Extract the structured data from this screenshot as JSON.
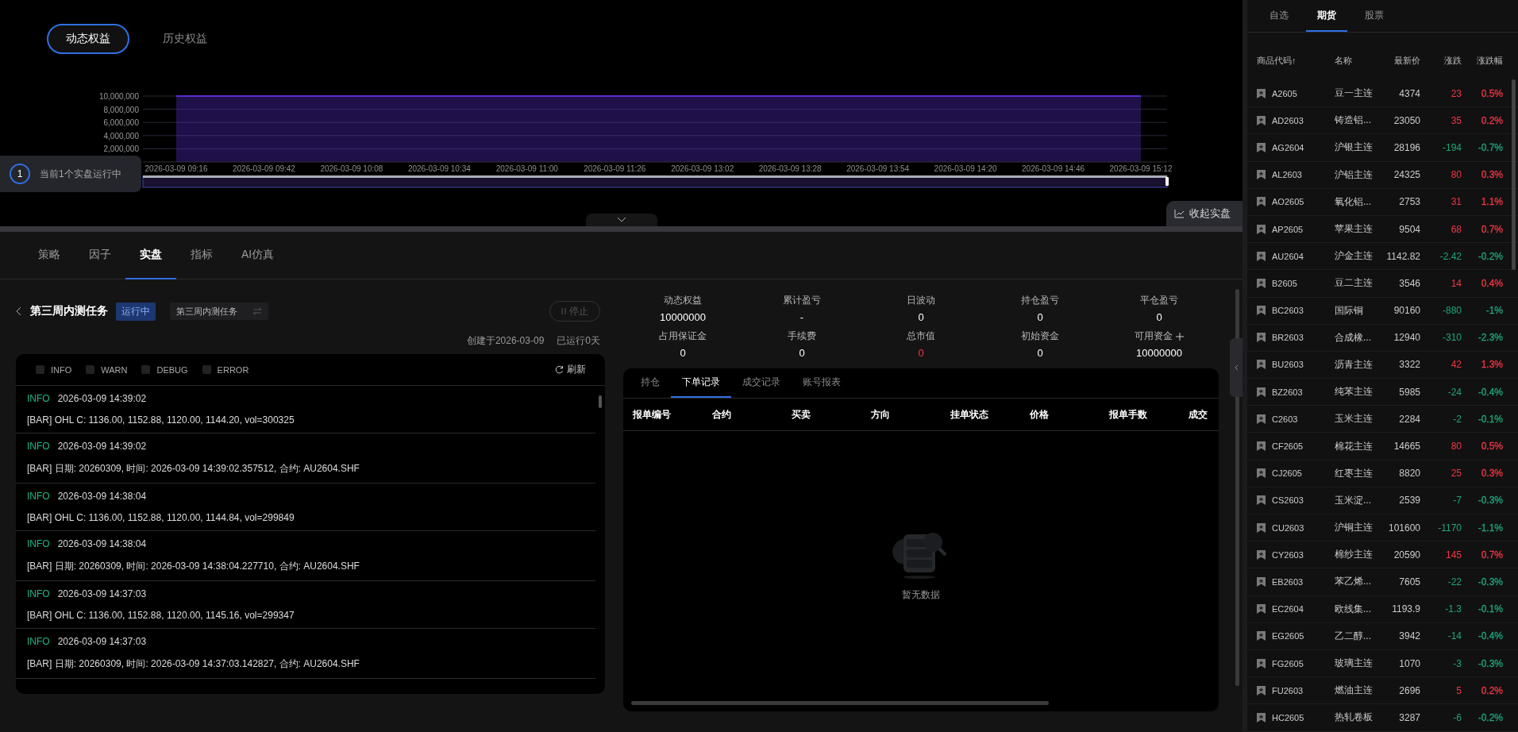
{
  "chart_tabs": [
    {
      "label": "动态权益",
      "selected": true
    },
    {
      "label": "历史权益",
      "selected": false
    }
  ],
  "equity_chart": {
    "chart_data": {
      "type": "area",
      "categories": [
        "2026-03-09 09:16",
        "2026-03-09 09:42",
        "2026-03-09 10:08",
        "2026-03-09 10:34",
        "2026-03-09 11:00",
        "2026-03-09 11:26",
        "2026-03-09 13:02",
        "2026-03-09 13:28",
        "2026-03-09 13:54",
        "2026-03-09 14:20",
        "2026-03-09 14:46",
        "2026-03-09 15:12"
      ],
      "series": [
        {
          "color": "#5a2fd0",
          "values": [
            10000000,
            10000000,
            10000000,
            10000000,
            10000000,
            10000000,
            10000000,
            10000000,
            10000000,
            10000000,
            10000000,
            10000000
          ]
        }
      ],
      "ylim": [
        0,
        10000000
      ],
      "grid": true,
      "yticks": [
        {
          "value": 2000000,
          "label": "2,000,000"
        },
        {
          "value": 4000000,
          "label": "4,000,000"
        },
        {
          "value": 6000000,
          "label": "6,000,000"
        },
        {
          "value": 8000000,
          "label": "8,000,000"
        },
        {
          "value": 10000000,
          "label": "10,000,000"
        }
      ]
    }
  },
  "running_notice": {
    "count": "1",
    "text": "当前1个实盘运行中"
  },
  "collapse_button": "收起实盘",
  "main_tabs": [
    {
      "label": "策略",
      "selected": false
    },
    {
      "label": "因子",
      "selected": false
    },
    {
      "label": "实盘",
      "selected": true
    },
    {
      "label": "指标",
      "selected": false
    },
    {
      "label": "AI仿真",
      "selected": false
    }
  ],
  "task": {
    "title": "第三周内测任务",
    "status": "运行中",
    "selector": "第三周内测任务",
    "stop_button": "停止",
    "disabled": true,
    "created": "创建于2026-03-09",
    "runtime": "已运行0天"
  },
  "stats": [
    {
      "label": "动态权益",
      "value": "10000000",
      "kind": "plain"
    },
    {
      "label": "累计盈亏",
      "value": "-",
      "kind": "plain"
    },
    {
      "label": "日波动",
      "value": "0",
      "kind": "plain"
    },
    {
      "label": "持仓盈亏",
      "value": "0",
      "kind": "plain"
    },
    {
      "label": "平仓盈亏",
      "value": "0",
      "kind": "plain"
    },
    {
      "label": "占用保证金",
      "value": "0",
      "kind": "plain"
    },
    {
      "label": "手续费",
      "value": "0",
      "kind": "plain"
    },
    {
      "label": "总市值",
      "value": "0",
      "kind": "alert"
    },
    {
      "label": "初始资金",
      "value": "0",
      "kind": "plain"
    },
    {
      "label": "可用资金",
      "value": "10000000",
      "kind": "add"
    }
  ],
  "log_panel": {
    "filters": [
      {
        "label": "INFO",
        "checked": false
      },
      {
        "label": "WARN",
        "checked": false
      },
      {
        "label": "DEBUG",
        "checked": false
      },
      {
        "label": "ERROR",
        "checked": false
      }
    ],
    "refresh": "刷新",
    "entries": [
      {
        "level": "INFO",
        "time": "2026-03-09 14:39:02",
        "message": "[BAR] OHL C: 1136.00, 1152.88, 1120.00, 1144.20, vol=300325"
      },
      {
        "level": "INFO",
        "time": "2026-03-09 14:39:02",
        "message": "[BAR] 日期: 20260309, 时间: 2026-03-09 14:39:02.357512, 合约: AU2604.SHF"
      },
      {
        "level": "INFO",
        "time": "2026-03-09 14:38:04",
        "message": "[BAR] OHL C: 1136.00, 1152.88, 1120.00, 1144.84, vol=299849"
      },
      {
        "level": "INFO",
        "time": "2026-03-09 14:38:04",
        "message": "[BAR] 日期: 20260309, 时间: 2026-03-09 14:38:04.227710, 合约: AU2604.SHF"
      },
      {
        "level": "INFO",
        "time": "2026-03-09 14:37:03",
        "message": "[BAR] OHL C: 1136.00, 1152.88, 1120.00, 1145.16, vol=299347"
      },
      {
        "level": "INFO",
        "time": "2026-03-09 14:37:03",
        "message": "[BAR] 日期: 20260309, 时间: 2026-03-09 14:37:03.142827, 合约: AU2604.SHF"
      }
    ]
  },
  "orders_panel": {
    "tabs": [
      {
        "label": "持仓",
        "selected": false
      },
      {
        "label": "下单记录",
        "selected": true
      },
      {
        "label": "成交记录",
        "selected": false
      },
      {
        "label": "账号报表",
        "selected": false
      }
    ],
    "columns": [
      "报单编号",
      "合约",
      "买卖",
      "方向",
      "挂单状态",
      "价格",
      "报单手数",
      "成交"
    ],
    "empty_text": "暂无数据"
  },
  "watchlist": {
    "tabs": [
      {
        "label": "自选",
        "selected": false
      },
      {
        "label": "期货",
        "selected": true
      },
      {
        "label": "股票",
        "selected": false
      }
    ],
    "columns": [
      "商品代码↑",
      "名称",
      "最新价",
      "涨跌",
      "涨跌幅"
    ],
    "rows": [
      {
        "code": "A2605",
        "name": "豆一主连",
        "price": "4374",
        "change": "23",
        "pct": "0.5%",
        "color": "#f23645"
      },
      {
        "code": "AD2603",
        "name": "铸造铝...",
        "price": "23050",
        "change": "35",
        "pct": "0.2%",
        "color": "#f23645"
      },
      {
        "code": "AG2604",
        "name": "沪银主连",
        "price": "28196",
        "change": "-194",
        "pct": "-0.7%",
        "color": "#1fa67a"
      },
      {
        "code": "AL2603",
        "name": "沪铝主连",
        "price": "24325",
        "change": "80",
        "pct": "0.3%",
        "color": "#f23645"
      },
      {
        "code": "AO2605",
        "name": "氧化铝...",
        "price": "2753",
        "change": "31",
        "pct": "1.1%",
        "color": "#f23645"
      },
      {
        "code": "AP2605",
        "name": "苹果主连",
        "price": "9504",
        "change": "68",
        "pct": "0.7%",
        "color": "#f23645"
      },
      {
        "code": "AU2604",
        "name": "沪金主连",
        "price": "1142.82",
        "change": "-2.42",
        "pct": "-0.2%",
        "color": "#1fa67a"
      },
      {
        "code": "B2605",
        "name": "豆二主连",
        "price": "3546",
        "change": "14",
        "pct": "0.4%",
        "color": "#f23645"
      },
      {
        "code": "BC2603",
        "name": "国际铜",
        "price": "90160",
        "change": "-880",
        "pct": "-1%",
        "color": "#1fa67a"
      },
      {
        "code": "BR2603",
        "name": "合成橡...",
        "price": "12940",
        "change": "-310",
        "pct": "-2.3%",
        "color": "#1fa67a"
      },
      {
        "code": "BU2603",
        "name": "沥青主连",
        "price": "3322",
        "change": "42",
        "pct": "1.3%",
        "color": "#f23645"
      },
      {
        "code": "BZ2603",
        "name": "纯苯主连",
        "price": "5985",
        "change": "-24",
        "pct": "-0.4%",
        "color": "#1fa67a"
      },
      {
        "code": "C2603",
        "name": "玉米主连",
        "price": "2284",
        "change": "-2",
        "pct": "-0.1%",
        "color": "#1fa67a"
      },
      {
        "code": "CF2605",
        "name": "棉花主连",
        "price": "14665",
        "change": "80",
        "pct": "0.5%",
        "color": "#f23645"
      },
      {
        "code": "CJ2605",
        "name": "红枣主连",
        "price": "8820",
        "change": "25",
        "pct": "0.3%",
        "color": "#f23645"
      },
      {
        "code": "CS2603",
        "name": "玉米淀...",
        "price": "2539",
        "change": "-7",
        "pct": "-0.3%",
        "color": "#1fa67a"
      },
      {
        "code": "CU2603",
        "name": "沪铜主连",
        "price": "101600",
        "change": "-1170",
        "pct": "-1.1%",
        "color": "#1fa67a"
      },
      {
        "code": "CY2603",
        "name": "棉纱主连",
        "price": "20590",
        "change": "145",
        "pct": "0.7%",
        "color": "#f23645"
      },
      {
        "code": "EB2603",
        "name": "苯乙烯...",
        "price": "7605",
        "change": "-22",
        "pct": "-0.3%",
        "color": "#1fa67a"
      },
      {
        "code": "EC2604",
        "name": "欧线集...",
        "price": "1193.9",
        "change": "-1.3",
        "pct": "-0.1%",
        "color": "#1fa67a"
      },
      {
        "code": "EG2605",
        "name": "乙二醇...",
        "price": "3942",
        "change": "-14",
        "pct": "-0.4%",
        "color": "#1fa67a"
      },
      {
        "code": "FG2605",
        "name": "玻璃主连",
        "price": "1070",
        "change": "-3",
        "pct": "-0.3%",
        "color": "#1fa67a"
      },
      {
        "code": "FU2603",
        "name": "燃油主连",
        "price": "2696",
        "change": "5",
        "pct": "0.2%",
        "color": "#f23645"
      },
      {
        "code": "HC2605",
        "name": "热轧卷板",
        "price": "3287",
        "change": "-6",
        "pct": "-0.2%",
        "color": "#1fa67a"
      }
    ]
  }
}
